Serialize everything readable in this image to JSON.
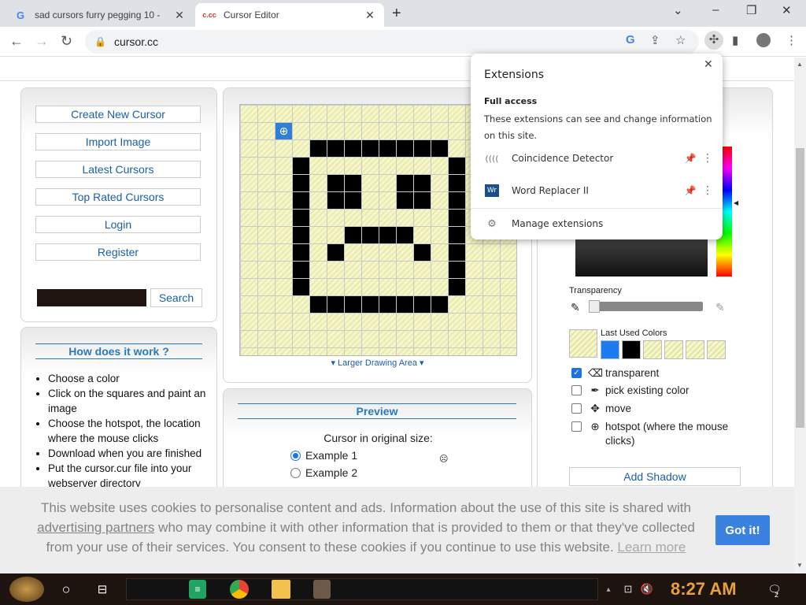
{
  "browser": {
    "tabs": [
      {
        "title": "sad cursors furry pegging 10 -",
        "favicon": "G",
        "active": false
      },
      {
        "title": "Cursor Editor",
        "favicon": "c.cc",
        "active": true
      }
    ],
    "url": "cursor.cc"
  },
  "sidebar": {
    "menu": [
      "Create New Cursor",
      "Import Image",
      "Latest Cursors",
      "Top Rated Cursors",
      "Login",
      "Register"
    ],
    "search_label": "Search"
  },
  "how": {
    "title": "How does it work ?",
    "steps": [
      "Choose a color",
      "Click on the squares and paint an image",
      "Choose the hotspot, the location where the mouse clicks",
      "Download when you are finished",
      "Put the cursor.cur file into your webserver directory"
    ]
  },
  "editor": {
    "larger_label": "Larger Drawing Area",
    "pixels": [
      [
        4,
        2
      ],
      [
        5,
        2
      ],
      [
        6,
        2
      ],
      [
        7,
        2
      ],
      [
        8,
        2
      ],
      [
        9,
        2
      ],
      [
        10,
        2
      ],
      [
        11,
        2
      ],
      [
        3,
        3
      ],
      [
        12,
        3
      ],
      [
        3,
        4
      ],
      [
        12,
        4
      ],
      [
        3,
        5
      ],
      [
        12,
        5
      ],
      [
        3,
        6
      ],
      [
        12,
        6
      ],
      [
        3,
        7
      ],
      [
        12,
        7
      ],
      [
        3,
        8
      ],
      [
        12,
        8
      ],
      [
        3,
        9
      ],
      [
        12,
        9
      ],
      [
        3,
        10
      ],
      [
        12,
        10
      ],
      [
        4,
        11
      ],
      [
        5,
        11
      ],
      [
        6,
        11
      ],
      [
        7,
        11
      ],
      [
        8,
        11
      ],
      [
        9,
        11
      ],
      [
        10,
        11
      ],
      [
        11,
        11
      ],
      [
        5,
        4
      ],
      [
        6,
        4
      ],
      [
        5,
        5
      ],
      [
        6,
        5
      ],
      [
        9,
        4
      ],
      [
        10,
        4
      ],
      [
        9,
        5
      ],
      [
        10,
        5
      ],
      [
        6,
        7
      ],
      [
        7,
        7
      ],
      [
        8,
        7
      ],
      [
        9,
        7
      ],
      [
        5,
        8
      ],
      [
        10,
        8
      ]
    ],
    "hotspot": [
      2,
      1
    ]
  },
  "preview": {
    "title": "Preview",
    "subtitle": "Cursor in original size:",
    "examples": [
      "Example 1",
      "Example 2"
    ],
    "selected": 0
  },
  "colors": {
    "transparency_label": "Transparency",
    "last_used_label": "Last Used Colors",
    "swatches": [
      "#1a7cf0",
      "#000000",
      "transparent",
      "transparent",
      "transparent",
      "transparent"
    ],
    "options": [
      {
        "label": "transparent",
        "checked": true,
        "icon": "eraser-icon"
      },
      {
        "label": "pick existing color",
        "checked": false,
        "icon": "eyedropper-icon"
      },
      {
        "label": "move",
        "checked": false,
        "icon": "move-icon"
      },
      {
        "label": "hotspot (where the mouse clicks)",
        "checked": false,
        "icon": "crosshair-icon"
      }
    ],
    "add_shadow": "Add Shadow"
  },
  "extensions": {
    "title": "Extensions",
    "access_title": "Full access",
    "access_desc": "These extensions can see and change information on this site.",
    "items": [
      {
        "name": "Coincidence Detector",
        "icon": "(((("
      },
      {
        "name": "Word Replacer II",
        "icon": "Wr"
      }
    ],
    "manage": "Manage extensions"
  },
  "cookie": {
    "part1": "This website uses cookies to personalise content and ads. Information about the use of this site is shared with ",
    "link1": "advertising partners",
    "part2": " who may combine it with other information that is provided to them or that they've collected from your use of their services. You consent to these cookies if you continue to use this website. ",
    "link2": "Learn more",
    "button": "Got it!"
  },
  "taskbar": {
    "time": "8:27 AM",
    "notifications": "2"
  }
}
